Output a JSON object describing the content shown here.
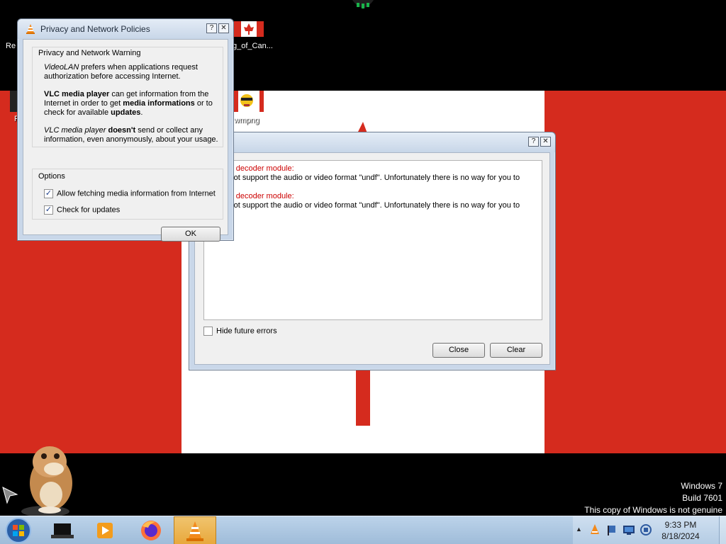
{
  "desktop": {
    "icons": [
      {
        "label": "Re"
      },
      {
        "label": "g_of_Can..."
      },
      {
        "label": "F"
      },
      {
        "label": "wmpng"
      }
    ]
  },
  "privacy_dialog": {
    "title": "Privacy and Network Policies",
    "help_label": "?",
    "close_label": "✕",
    "group_warning_label": "Privacy and Network Warning",
    "p1_italic": "VideoLAN",
    "p1_rest": " prefers when applications request authorization before accessing Internet.",
    "p2_bold1": "VLC media player",
    "p2_text1": " can get information from the Internet in order to get ",
    "p2_bold2": "media informations",
    "p2_text2": " or to check for available ",
    "p2_bold3": "updates",
    "p2_text3": ".",
    "p3_italic": "VLC media player",
    "p3_bold": " doesn't",
    "p3_rest": " send or collect any information, even anonymously, about your usage.",
    "group_options_label": "Options",
    "option_fetch_label": "Allow fetching media information from Internet",
    "option_fetch_checked": "✓",
    "option_updates_label": "Check for updates",
    "option_updates_checked": "✓",
    "ok_label": "OK"
  },
  "errors_dialog": {
    "help_label": "?",
    "close_label": "✕",
    "errors": [
      {
        "heading": "ble decoder module:",
        "message": "s not support the audio or video format \"undf\". Unfortunately there is no way for you to"
      },
      {
        "heading": "ble decoder module:",
        "message": "s not support the audio or video format \"undf\". Unfortunately there is no way for you to"
      }
    ],
    "hide_future_label": "Hide future errors",
    "close_button_label": "Close",
    "clear_button_label": "Clear"
  },
  "watermark": {
    "line1": "Windows 7",
    "line2": "Build 7601",
    "line3": "This copy of Windows is not genuine"
  },
  "taskbar": {
    "clock_time": "9:33 PM",
    "clock_date": "8/18/2024",
    "show_hidden_label": "▲"
  },
  "colors": {
    "flag_red": "#d52b1e",
    "error_red": "#cc0000",
    "taskbar": "#a9c4e0"
  }
}
